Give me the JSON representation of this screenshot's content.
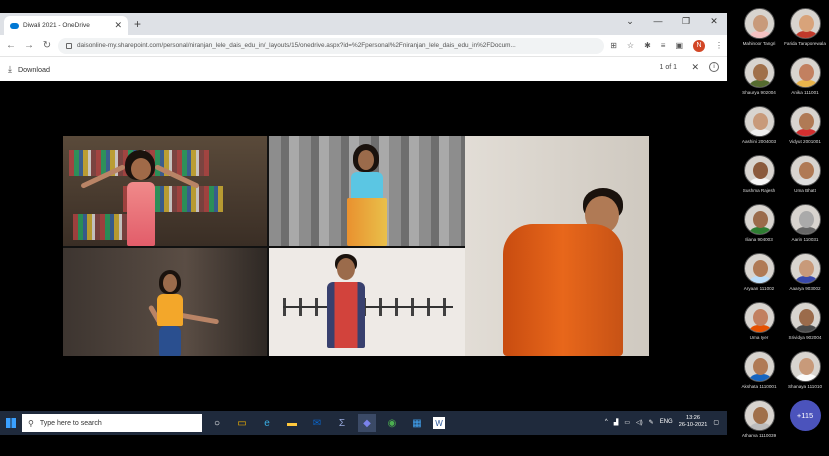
{
  "browser": {
    "tab_title": "Diwali 2021 - OneDrive",
    "new_tab": "+",
    "window_controls": [
      "⌄",
      "—",
      "❐",
      "✕"
    ],
    "url": "daisonline-my.sharepoint.com/personal/niranjan_lele_dais_edu_in/_layouts/15/onedrive.aspx?id=%2Fpersonal%2Fniranjan_lele_dais_edu_in%2FDocum...",
    "profile_initial": "N",
    "download_label": "Download",
    "pager": "1 of 1"
  },
  "participants": [
    {
      "name": "Mahinoor Tangri",
      "skin": "#c89a7a",
      "shirt": "#f4c2c2"
    },
    {
      "name": "Farida Taraporewala",
      "skin": "#d8a37a",
      "shirt": "#c0392b"
    },
    {
      "name": "Shaurya 902004",
      "skin": "#a0704a",
      "shirt": "#556b2f"
    },
    {
      "name": "Anika 111001",
      "skin": "#c28060",
      "shirt": "#e9b44c"
    },
    {
      "name": "Aashini 2004003",
      "skin": "#c89a7a",
      "shirt": "#eeeeee"
    },
    {
      "name": "Vidyut 2001001",
      "skin": "#b07a55",
      "shirt": "#d32f2f"
    },
    {
      "name": "Sushma Rajesh",
      "skin": "#8b5a3c",
      "shirt": "#f5f5f5"
    },
    {
      "name": "Uma Bhatt",
      "skin": "#b07a55",
      "shirt": "#ddd"
    },
    {
      "name": "Iliana 904003",
      "skin": "#9b6b4b",
      "shirt": "#2e7d32"
    },
    {
      "name": "Aarin 110031",
      "skin": "#aaaaaa",
      "shirt": "#666"
    },
    {
      "name": "Aryaan 111002",
      "skin": "#b07a55",
      "shirt": "#bbdefb"
    },
    {
      "name": "Aaarya 903002",
      "skin": "#c89a7a",
      "shirt": "#3949ab"
    },
    {
      "name": "Uma Iyer",
      "skin": "#c28060",
      "shirt": "#e65100"
    },
    {
      "name": "Srividya 902004",
      "skin": "#9b6b4b",
      "shirt": "#4a4a4a"
    },
    {
      "name": "Akshata 1110001",
      "skin": "#b07a55",
      "shirt": "#1565c0"
    },
    {
      "name": "Shanaya 111010",
      "skin": "#c89a7a",
      "shirt": "#fafafa"
    },
    {
      "name": "Atharva 1110039",
      "skin": "#a0704a",
      "shirt": "#bdbdbd"
    }
  ],
  "more_participants": "+115",
  "taskbar": {
    "search_placeholder": "Type here to search",
    "apps": [
      "task-view",
      "edge",
      "file-explorer",
      "outlook",
      "calculator",
      "teams",
      "chrome",
      "photos",
      "word"
    ],
    "lang": "ENG",
    "time": "13:26",
    "date": "26-10-2021"
  }
}
